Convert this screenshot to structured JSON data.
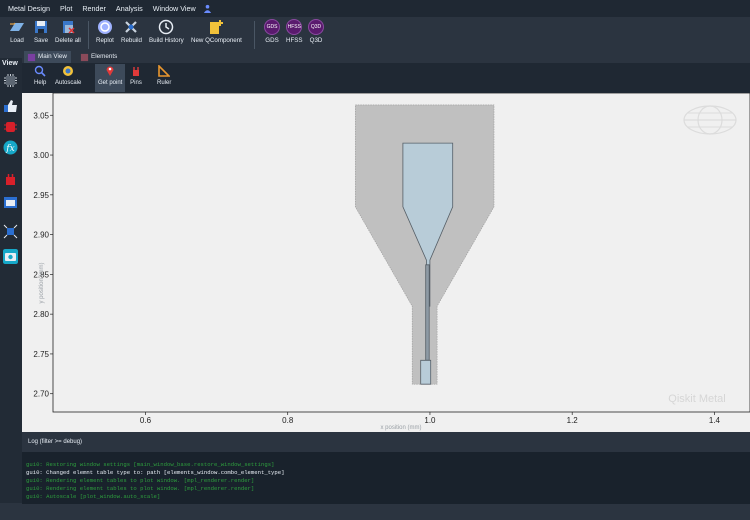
{
  "menu": [
    "Metal Design",
    "Plot",
    "Render",
    "Analysis",
    "Window View"
  ],
  "toolbar": {
    "buttons": [
      {
        "label": "Load",
        "icon": "load-icon"
      },
      {
        "label": "Save",
        "icon": "save-icon"
      },
      {
        "label": "Delete all",
        "icon": "delete-all-icon"
      },
      {
        "label": "Replot",
        "icon": "replot-icon"
      },
      {
        "label": "Rebuild",
        "icon": "rebuild-icon"
      },
      {
        "label": "Build History",
        "icon": "build-history-icon"
      },
      {
        "label": "New QComponent",
        "icon": "new-qcomponent-icon"
      }
    ],
    "renderers": [
      {
        "label": "GDS",
        "badge": "GDS"
      },
      {
        "label": "HFSS",
        "badge": "HFSS"
      },
      {
        "label": "Q3D",
        "badge": "Q3D"
      }
    ]
  },
  "sidebar": {
    "title": "View"
  },
  "tabs": [
    {
      "label": "Main View",
      "active": true
    },
    {
      "label": "Elements",
      "active": false
    }
  ],
  "subtoolbar": [
    {
      "label": "Help",
      "icon": "help-icon"
    },
    {
      "label": "Autoscale",
      "icon": "autoscale-icon"
    },
    {
      "label": "Get point",
      "icon": "get-point-icon",
      "active": true
    },
    {
      "label": "Pins",
      "icon": "pins-icon"
    },
    {
      "label": "Ruler",
      "icon": "ruler-icon"
    }
  ],
  "plot": {
    "watermark": "Qiskit Metal",
    "xlabel": "x position (mm)",
    "ylabel": "y position (mm)",
    "xticks": [
      "0.6",
      "0.8",
      "1.0",
      "1.2",
      "1.4"
    ],
    "yticks": [
      "3.05",
      "3.00",
      "2.95",
      "2.90",
      "2.85",
      "2.80",
      "2.75",
      "2.70"
    ],
    "colors": {
      "ground": "#c0c0c0",
      "metal": "#b8ccd8",
      "outline": "#555e66"
    }
  },
  "chart_data": {
    "type": "scatter",
    "title": "",
    "xlabel": "x position (mm)",
    "ylabel": "y position (mm)",
    "xlim": [
      0.47,
      1.45
    ],
    "ylim": [
      2.677,
      3.078
    ],
    "grid": false,
    "shapes": [
      {
        "name": "ground-cutout",
        "points": [
          [
            0.895,
            3.063
          ],
          [
            1.09,
            3.063
          ],
          [
            1.09,
            2.935
          ],
          [
            1.01,
            2.81
          ],
          [
            1.01,
            2.712
          ],
          [
            0.975,
            2.712
          ],
          [
            0.975,
            2.81
          ],
          [
            0.895,
            2.935
          ]
        ]
      },
      {
        "name": "pad",
        "points": [
          [
            0.962,
            3.015
          ],
          [
            1.032,
            3.015
          ],
          [
            1.032,
            2.935
          ],
          [
            1.0,
            2.868
          ],
          [
            1.0,
            2.81
          ],
          [
            0.995,
            2.81
          ],
          [
            0.995,
            2.868
          ],
          [
            0.962,
            2.935
          ]
        ]
      },
      {
        "name": "feed",
        "points": [
          [
            0.994,
            2.862
          ],
          [
            0.999,
            2.862
          ],
          [
            0.999,
            2.742
          ],
          [
            0.994,
            2.742
          ]
        ]
      },
      {
        "name": "tip",
        "points": [
          [
            0.987,
            2.742
          ],
          [
            1.001,
            2.742
          ],
          [
            1.001,
            2.712
          ],
          [
            0.987,
            2.712
          ]
        ]
      }
    ]
  },
  "log": {
    "header": "Log  (filter >= debug)",
    "lines": [
      {
        "text": "gui0: Restoring window settings    [main_window_base.restore_window_settings]",
        "color": "#2e9e3e"
      },
      {
        "text": "gui0: Changed elemnt table type to: path [elements_window.combo_element_type]",
        "color": "#e8eef5"
      },
      {
        "text": "gui0: Rendering element tables to plot window. [mpl_renderer.render]",
        "color": "#2e9e3e"
      },
      {
        "text": "gui0: Rendering element tables to plot window. [mpl_renderer.render]",
        "color": "#2e9e3e"
      },
      {
        "text": "gui0: Autoscale [plot_window.auto_scale]",
        "color": "#2e9e3e"
      }
    ]
  }
}
